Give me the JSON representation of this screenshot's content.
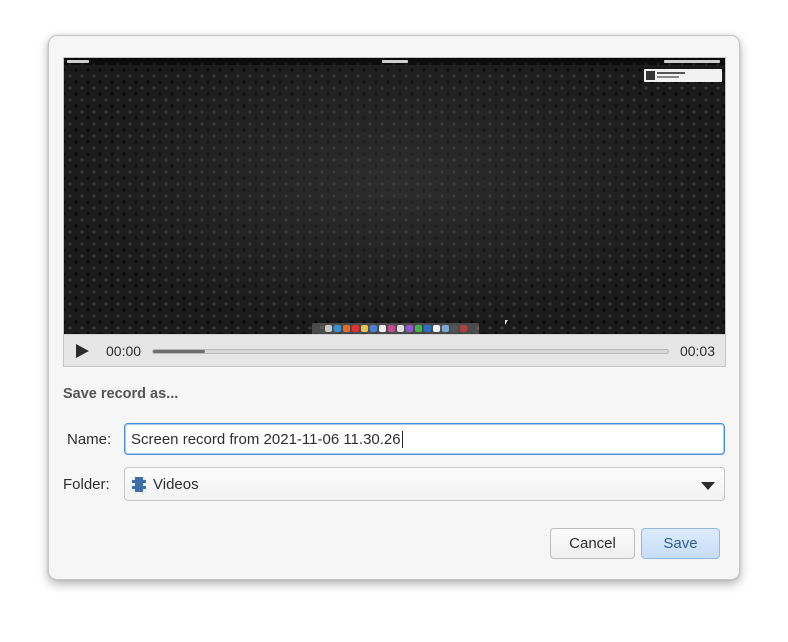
{
  "dialog": {
    "heading": "Save record as...",
    "player": {
      "current_time": "00:00",
      "total_time": "00:03",
      "progress": 0.1
    },
    "name_field": {
      "label": "Name:",
      "value": "Screen record from 2021-11-06 11.30.26"
    },
    "folder_field": {
      "label": "Folder:",
      "icon": "video-folder-icon",
      "value": "Videos"
    },
    "buttons": {
      "cancel": "Cancel",
      "save": "Save"
    }
  },
  "colors": {
    "focus_border": "#4a90d9",
    "save_button_bg": "#c7def6",
    "save_button_text": "#2d5b90"
  }
}
